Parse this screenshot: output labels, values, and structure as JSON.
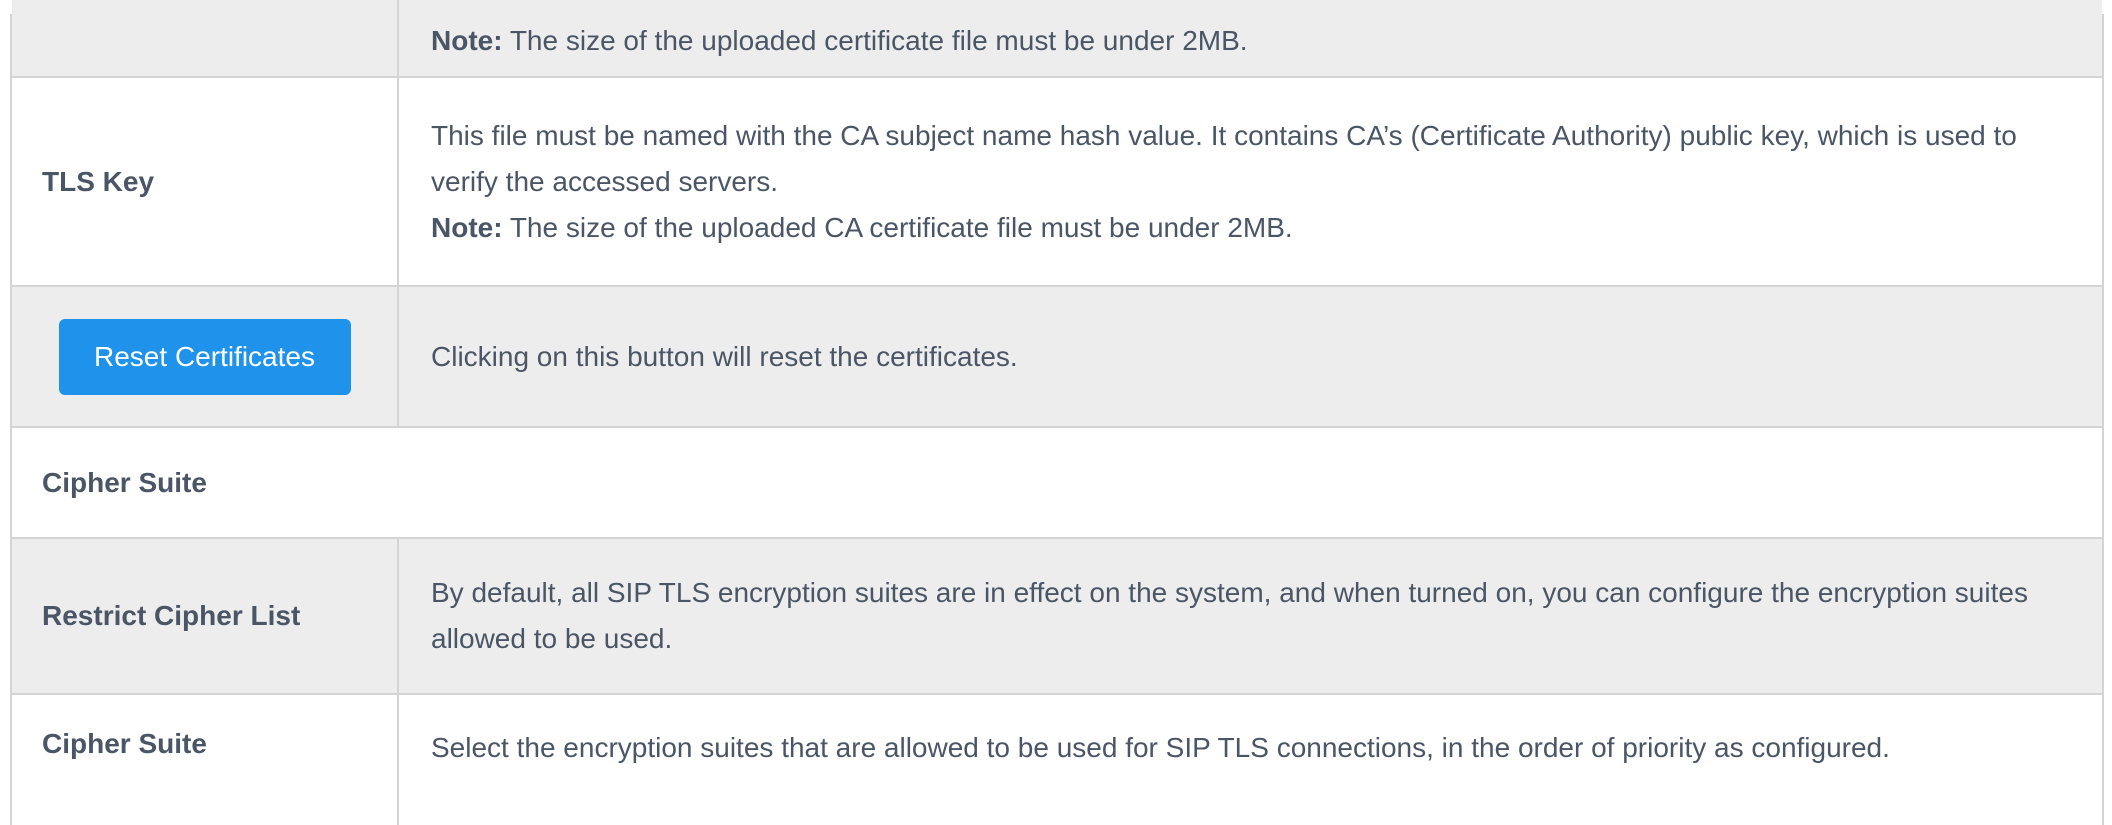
{
  "rows": [
    {
      "note_label": "Note:",
      "note_text": " The size of the uploaded certificate file must be under 2MB."
    },
    {
      "label": "TLS Key",
      "description": "This file must be named with the CA subject name hash value. It contains CA’s (Certificate Authority) public key, which is used to verify the accessed servers.",
      "note_label": "Note:",
      "note_text": " The size of the uploaded CA certificate file must be under 2MB."
    },
    {
      "button_label": "Reset Certificates",
      "description": "Clicking on this button will reset the certificates."
    },
    {
      "section_title": "Cipher Suite"
    },
    {
      "label": "Restrict Cipher List",
      "description": "By default, all SIP TLS encryption suites are in effect on the system, and when turned on, you can configure the encryption suites allowed to be used."
    },
    {
      "label": "Cipher Suite",
      "description": "Select the encryption suites that are allowed to be used for SIP TLS connections, in the order of priority as configured."
    }
  ],
  "colors": {
    "button_bg": "#1f93eb",
    "row_grey": "#ededed",
    "text": "#4a5566",
    "border": "#d4d4d4"
  }
}
